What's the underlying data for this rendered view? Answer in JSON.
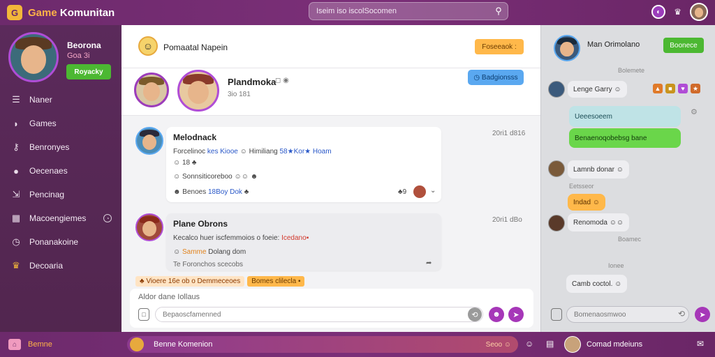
{
  "app": {
    "title_prefix": "Game",
    "title_suffix": " Komunitan",
    "logo_glyph": "G"
  },
  "search": {
    "placeholder": "Iseim iso iscolSocomen"
  },
  "top_icons": {
    "notifications": "◐",
    "crown": "♛"
  },
  "profile": {
    "name": "Beorona",
    "sub": "Goa 3i",
    "status_button": "Royacky"
  },
  "nav": [
    {
      "label": "Naner",
      "icon": "menu-bars-icon",
      "glyph": "☰"
    },
    {
      "label": "Games",
      "icon": "controller-icon",
      "glyph": "◗"
    },
    {
      "label": "Benronyes",
      "icon": "key-icon",
      "glyph": "⚷"
    },
    {
      "label": "Oecenaes",
      "icon": "user-icon",
      "glyph": "●"
    },
    {
      "label": "Pencinag",
      "icon": "inbox-icon",
      "glyph": "⇲"
    },
    {
      "label": "Macoengiemes",
      "icon": "grid-icon",
      "glyph": "▦",
      "badge": "◔"
    },
    {
      "label": "Ponanakoine",
      "icon": "clock-icon",
      "glyph": "◷"
    },
    {
      "label": "Decoaria",
      "icon": "crown-icon",
      "glyph": "♛"
    }
  ],
  "main": {
    "header_emoji": "☺",
    "header_title": "Pomaatal Napein",
    "header_button": "Foseeaok :",
    "group": {
      "name": "Plandmoka",
      "meta": "3io 181",
      "tools": "◻ ◉"
    },
    "group_button": "◷ Badgionsss"
  },
  "messages": [
    {
      "author": "Melodnack",
      "time": "20ri1 d816",
      "line1_a": "Forcelinoc ",
      "line1_b": "kes Kiooe",
      "line1_c": " ☺ Himiliang ",
      "line1_d": "58★Kor★",
      "line1_e": " Hoam",
      "line2": "☺ 18 ♣",
      "line3": "☺ Sonnsiticoreboo ☺☺ ☻",
      "line4_a": "☻ Benoes ",
      "line4_b": "18Boy Dok",
      "line4_c": " ♣",
      "reactions": "♣9"
    },
    {
      "author": "Plane Obrons",
      "time": "20ri1 dBo",
      "line1_a": "Kecalco ",
      "line1_b": "huer iscfemmoios o foeie:",
      "line1_c": " Icedano",
      "line1_d": "▪",
      "line2_a": "☺ ",
      "line2_b": "Samme",
      "line2_c": " Dolang dom",
      "line3": "Te Foronchos scecobs"
    }
  ],
  "notice": {
    "left": "♣ Vioere 16e ob o Demmeceoes",
    "right": "Bomes clilecla ▪"
  },
  "composer": {
    "label": "Aldor dane Iollaus",
    "placeholder": "Bepaoscfamenned"
  },
  "right_panel": {
    "name": "Man Orimolano",
    "button": "Boonece",
    "chats": [
      {
        "time": "Bolemete",
        "text": "Lenge Garry ☺",
        "style": "gray"
      },
      {
        "text": "Ueeesoeem",
        "style": "teal"
      },
      {
        "text": "Benaenoqobebsg bane",
        "style": "green"
      },
      {
        "text": "Lamnb donar ☺",
        "style": "gray",
        "time": "Eetsseor"
      },
      {
        "text": "Indad ☺",
        "style": "orange"
      },
      {
        "text": "Renomoda ☺☺",
        "style": "gray",
        "time": "Boamec"
      },
      {
        "time": "Ionee",
        "text": "Camb coctol. ☺",
        "style": "gray"
      }
    ],
    "composer_placeholder": "Bomenaosmwoo"
  },
  "bottom": {
    "home_label": "Bemne",
    "now_playing": "Benne Komenion",
    "now_playing_right": "Seoo ☺",
    "user_name": "Comad mdeiuns"
  },
  "colors": {
    "brand": "#6d2a6c",
    "accent_purple": "#a637b8",
    "accent_orange": "#ffb84a",
    "accent_green": "#4cb832",
    "accent_blue": "#5aa8f0"
  }
}
